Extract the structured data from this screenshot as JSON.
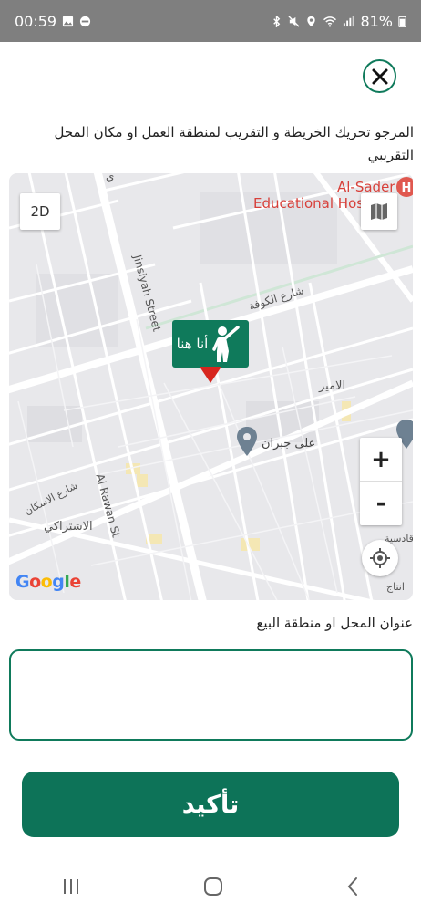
{
  "status_bar": {
    "time": "00:59",
    "battery": "81%",
    "icons": [
      "image-icon",
      "dnd-icon",
      "bluetooth-icon",
      "mute-icon",
      "location-icon",
      "wifi-icon",
      "signal-icon",
      "battery-icon"
    ]
  },
  "dialog": {
    "close_icon": "close-icon",
    "instruction": "المرجو تحريك الخريطة و التقريب لمنطقة العمل او مكان المحل التقريبي"
  },
  "map": {
    "btn_2d": "2D",
    "zoom_in": "+",
    "zoom_out": "-",
    "marker_label": "أنا هنا",
    "google_logo": "Google",
    "labels": {
      "hospital_line1": "Al-Sader",
      "hospital_line2": "Educational Hospital",
      "street_jinsiyah": "Jinsiyah Street",
      "street_kufa": "شارع الكوفة",
      "place_amir": "الامير",
      "place_ali": "على جبران",
      "street_rawan": "Al Rawan St",
      "street_askan": "شارع الاسكان",
      "place_ishtiraki": "الاشتراكي",
      "place_qadisiya": "قادسية",
      "place_intaj": "انتاج",
      "edge_label": "ي"
    }
  },
  "form": {
    "address_label": "عنوان المحل او منطقة البيع",
    "address_value": "",
    "confirm_label": "تأكيد"
  },
  "nav": {
    "icons": [
      "recent-apps-icon",
      "home-icon",
      "back-icon"
    ]
  },
  "colors": {
    "primary": "#0f7a5b",
    "marker_tip": "#d7261e",
    "status_bar": "#7f7f7f"
  }
}
